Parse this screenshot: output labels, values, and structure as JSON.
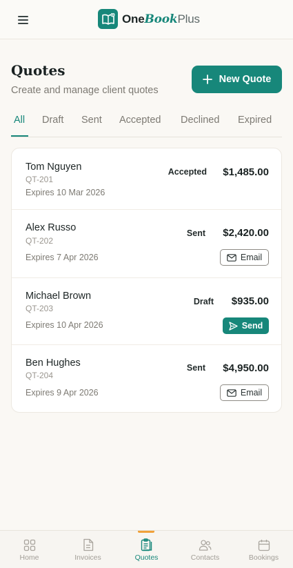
{
  "header": {
    "logo_one": "One",
    "logo_book": "Book",
    "logo_plus": "Plus",
    "menu_icon": "hamburger-icon",
    "logo_icon": "book-logo-icon"
  },
  "page": {
    "title": "Quotes",
    "subtitle": "Create and manage client quotes",
    "new_quote_label": "New Quote"
  },
  "tabs": [
    {
      "label": "All",
      "active": true
    },
    {
      "label": "Draft",
      "active": false
    },
    {
      "label": "Sent",
      "active": false
    },
    {
      "label": "Accepted",
      "active": false
    },
    {
      "label": "Declined",
      "active": false
    },
    {
      "label": "Expired",
      "active": false
    }
  ],
  "quotes": [
    {
      "client": "Tom Nguyen",
      "number": "QT-201",
      "expires": "Expires 10 Mar 2026",
      "status": "Accepted",
      "amount": "$1,485.00",
      "action": ""
    },
    {
      "client": "Alex Russo",
      "number": "QT-202",
      "expires": "Expires 7 Apr 2026",
      "status": "Sent",
      "amount": "$2,420.00",
      "action": "Email"
    },
    {
      "client": "Michael Brown",
      "number": "QT-203",
      "expires": "Expires 10 Apr 2026",
      "status": "Draft",
      "amount": "$935.00",
      "action": "Send"
    },
    {
      "client": "Ben Hughes",
      "number": "QT-204",
      "expires": "Expires 9 Apr 2026",
      "status": "Sent",
      "amount": "$4,950.00",
      "action": "Email"
    }
  ],
  "nav": [
    {
      "label": "Home",
      "icon": "grid-icon",
      "active": false
    },
    {
      "label": "Invoices",
      "icon": "document-icon",
      "active": false
    },
    {
      "label": "Quotes",
      "icon": "clipboard-icon",
      "active": true
    },
    {
      "label": "Contacts",
      "icon": "users-icon",
      "active": false
    },
    {
      "label": "Bookings",
      "icon": "calendar-icon",
      "active": false
    }
  ],
  "colors": {
    "accent": "#17877a",
    "nav_indicator": "#f0a13a",
    "background": "#faf8f4"
  }
}
